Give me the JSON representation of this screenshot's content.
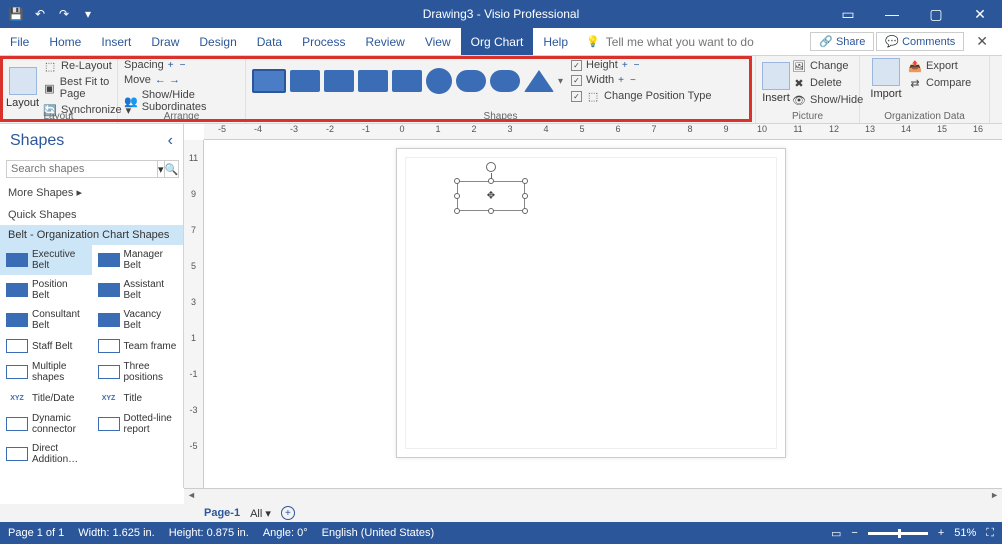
{
  "title": "Drawing3 - Visio Professional",
  "menu": {
    "tabs": [
      "File",
      "Home",
      "Insert",
      "Draw",
      "Design",
      "Data",
      "Process",
      "Review",
      "View",
      "Org Chart",
      "Help"
    ],
    "tellme_placeholder": "Tell me what you want to do",
    "share": "Share",
    "comments": "Comments"
  },
  "ribbon": {
    "layout": {
      "label": "Layout",
      "relayout": "Re-Layout",
      "bestfit": "Best Fit to Page",
      "sync": "Synchronize"
    },
    "arrange": {
      "label": "Arrange",
      "spacing": "Spacing",
      "move": "Move",
      "showhide": "Show/Hide Subordinates"
    },
    "shapes": {
      "label": "Shapes",
      "height": "Height",
      "width": "Width",
      "changepos": "Change Position Type"
    },
    "picture": {
      "label": "Picture",
      "insert": "Insert",
      "change": "Change",
      "delete": "Delete",
      "showhide": "Show/Hide"
    },
    "orgdata": {
      "label": "Organization Data",
      "import": "Import",
      "export": "Export",
      "compare": "Compare"
    }
  },
  "shapes_panel": {
    "title": "Shapes",
    "search_placeholder": "Search shapes",
    "more": "More Shapes",
    "quick": "Quick Shapes",
    "group": "Belt - Organization Chart Shapes",
    "items": [
      [
        "Executive Belt",
        "Manager Belt"
      ],
      [
        "Position Belt",
        "Assistant Belt"
      ],
      [
        "Consultant Belt",
        "Vacancy Belt"
      ],
      [
        "Staff Belt",
        "Team frame"
      ],
      [
        "Multiple shapes",
        "Three positions"
      ],
      [
        "Title/Date",
        "Title"
      ],
      [
        "Dynamic connector",
        "Dotted-line report"
      ],
      [
        "Direct Addition…",
        ""
      ]
    ]
  },
  "ruler_h": [
    "-5",
    "-4",
    "-3",
    "-2",
    "-1",
    "0",
    "1",
    "2",
    "3",
    "4",
    "5",
    "6",
    "7",
    "8",
    "9",
    "10",
    "11",
    "12",
    "13",
    "14",
    "15",
    "16"
  ],
  "ruler_v": [
    "11",
    "9",
    "7",
    "5",
    "3",
    "1",
    "-1",
    "-3",
    "-5"
  ],
  "tabbar": {
    "page": "Page-1",
    "all": "All"
  },
  "status": {
    "page": "Page 1 of 1",
    "width": "Width: 1.625 in.",
    "height": "Height: 0.875 in.",
    "angle": "Angle: 0°",
    "lang": "English (United States)",
    "zoom": "51%"
  }
}
